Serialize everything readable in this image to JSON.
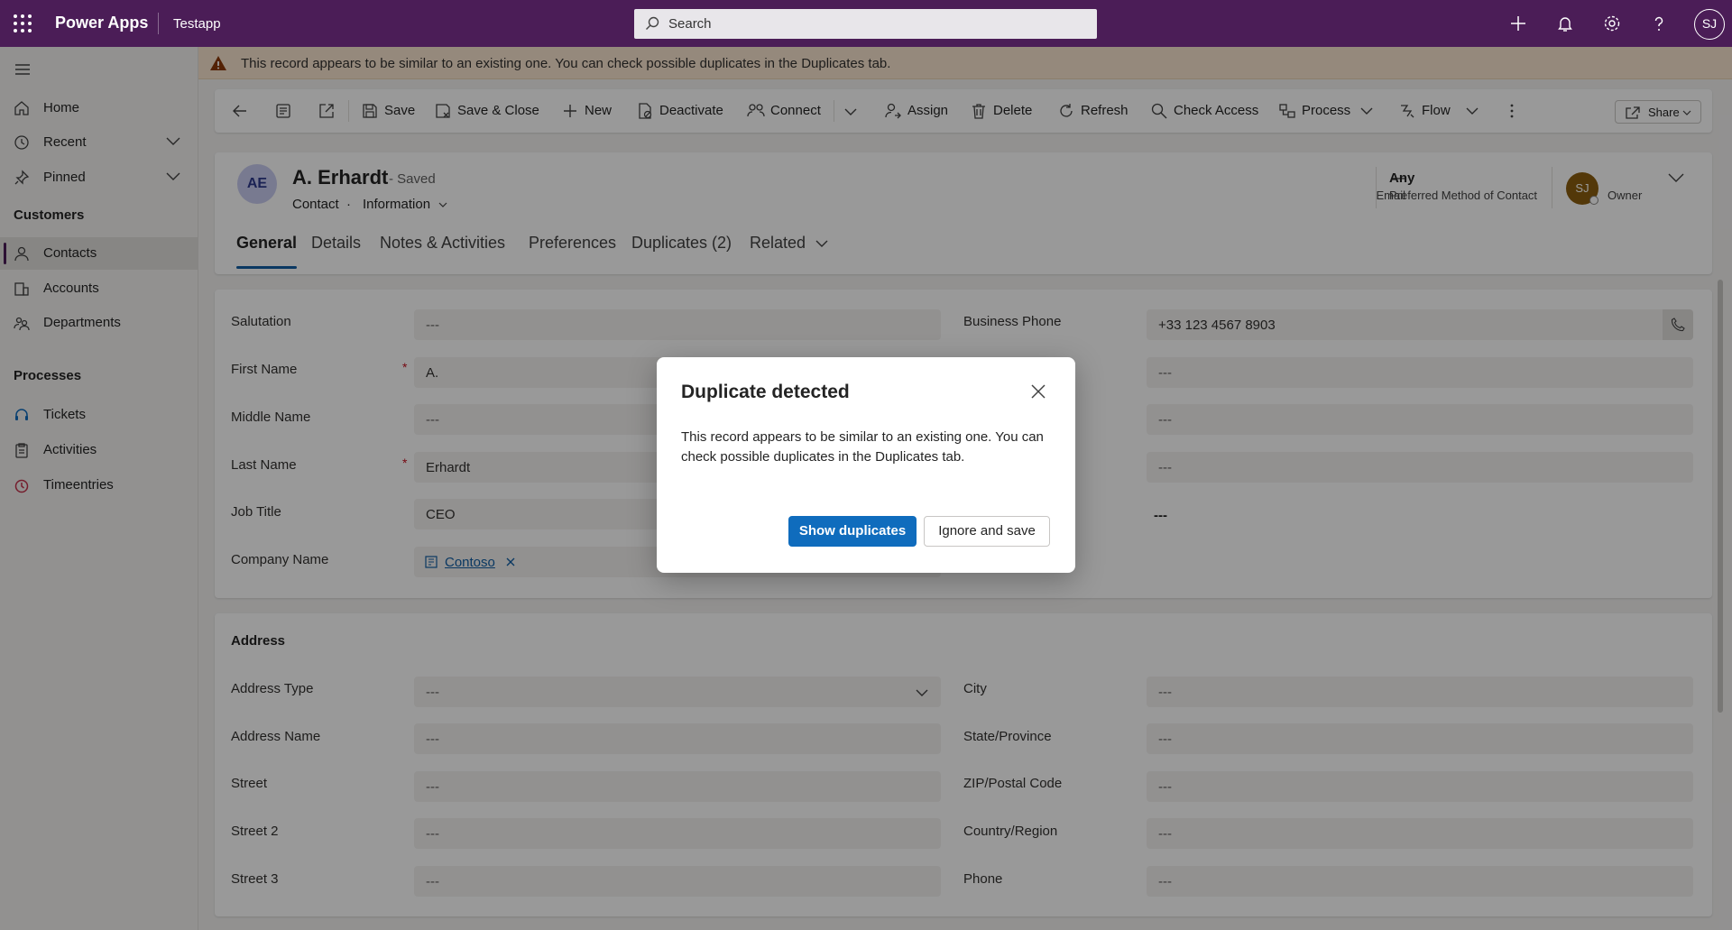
{
  "topbar": {
    "app_name": "Power Apps",
    "environment": "Testapp",
    "search_placeholder": "Search",
    "user_initials": "SJ",
    "color": "#4b1d57"
  },
  "sidebar": {
    "home": "Home",
    "recent": "Recent",
    "pinned": "Pinned",
    "customers_group": "Customers",
    "contacts": "Contacts",
    "accounts": "Accounts",
    "departments": "Departments",
    "processes_group": "Processes",
    "tickets": "Tickets",
    "activities": "Activities",
    "timeentries": "Timeentries"
  },
  "banner": {
    "message": "This record appears to be similar to an existing one. You can check possible duplicates in the Duplicates tab."
  },
  "commands": {
    "save": "Save",
    "save_close": "Save & Close",
    "new": "New",
    "deactivate": "Deactivate",
    "connect": "Connect",
    "assign": "Assign",
    "delete": "Delete",
    "refresh": "Refresh",
    "check_access": "Check Access",
    "process": "Process",
    "flow": "Flow",
    "share": "Share"
  },
  "record": {
    "initials": "AE",
    "name": "A. Erhardt",
    "status": "- Saved",
    "entity": "Contact",
    "separator": "·",
    "form": "Information",
    "email_value": "---",
    "email_label": "Email",
    "contact_method_value": "Any",
    "contact_method_label": "Preferred Method of Contact",
    "owner_initials": "SJ",
    "owner_label": "Owner"
  },
  "tabs": [
    "General",
    "Details",
    "Notes & Activities",
    "Preferences",
    "Duplicates (2)",
    "Related"
  ],
  "general": {
    "salutation_label": "Salutation",
    "salutation_value": "---",
    "first_name_label": "First Name",
    "first_name_value": "A.",
    "middle_name_label": "Middle Name",
    "middle_name_value": "---",
    "last_name_label": "Last Name",
    "last_name_value": "Erhardt",
    "job_title_label": "Job Title",
    "job_title_value": "CEO",
    "company_name_label": "Company Name",
    "company_name_value": "Contoso",
    "business_phone_label": "Business Phone",
    "business_phone_value": "+33 123 4567 8903",
    "right_empty_value": "---",
    "required_mark": "*"
  },
  "address": {
    "title": "Address",
    "address_type_label": "Address Type",
    "address_name_label": "Address Name",
    "street_label": "Street",
    "street2_label": "Street 2",
    "street3_label": "Street 3",
    "city_label": "City",
    "state_label": "State/Province",
    "zip_label": "ZIP/Postal Code",
    "country_label": "Country/Region",
    "phone_label": "Phone",
    "empty_value": "---"
  },
  "dialog": {
    "title": "Duplicate detected",
    "body": "This record appears to be similar to an existing one. You can check possible duplicates in the Duplicates tab.",
    "primary": "Show duplicates",
    "secondary": "Ignore and save"
  }
}
